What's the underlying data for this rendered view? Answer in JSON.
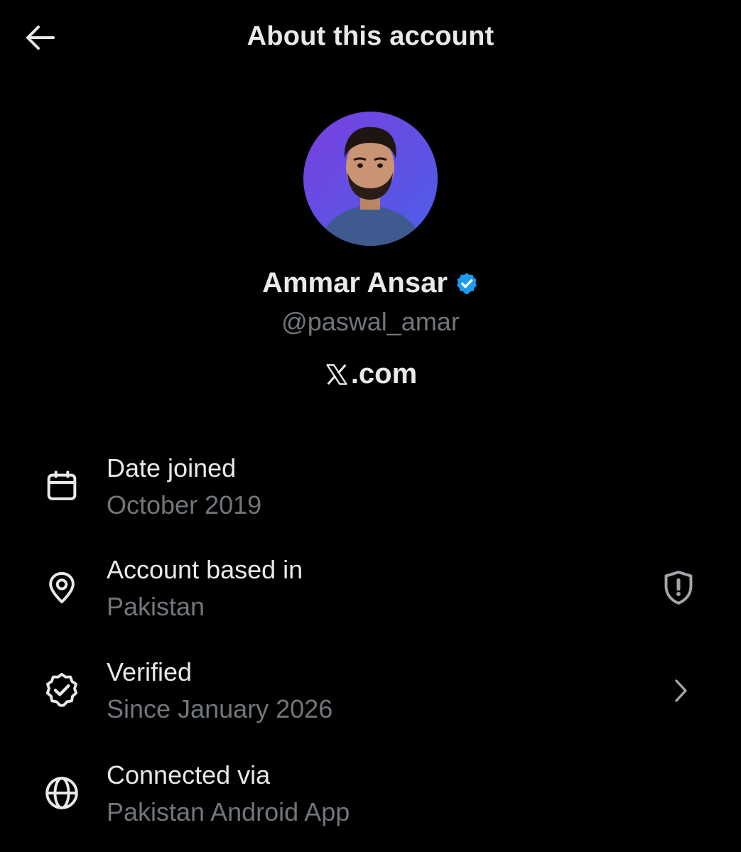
{
  "header": {
    "title": "About this account",
    "back_icon": "arrow-left-icon"
  },
  "profile": {
    "display_name": "Ammar Ansar",
    "handle": "@paswal_amar",
    "verified": true,
    "site_suffix": ".com",
    "avatar_bg_color": "#6a4fe0"
  },
  "details": [
    {
      "icon": "calendar-icon",
      "label": "Date joined",
      "value": "October 2019"
    },
    {
      "icon": "location-pin-icon",
      "label": "Account based in",
      "value": "Pakistan",
      "action_icon": "shield-alert-icon"
    },
    {
      "icon": "verified-badge-outline-icon",
      "label": "Verified",
      "value": "Since January 2026",
      "action_icon": "chevron-right-icon"
    },
    {
      "icon": "globe-icon",
      "label": "Connected via",
      "value": "Pakistan Android App"
    }
  ],
  "colors": {
    "background": "#000000",
    "primary_text": "#e7e9ea",
    "secondary_text": "#71767b",
    "verified_blue": "#1d9bf0"
  }
}
